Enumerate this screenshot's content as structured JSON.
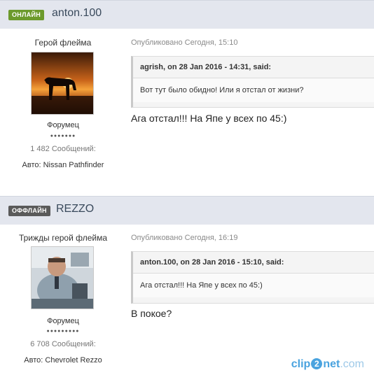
{
  "posts": [
    {
      "status": "ОНЛАЙН",
      "username": "anton.100",
      "rank": "Герой флейма",
      "group": "Форумец",
      "pips": "●●●●●●●",
      "post_count": "1 482 Сообщений:",
      "car": "Авто: Nissan Pathfinder",
      "published": "Опубликовано Сегодня, 15:10",
      "quote_header": "agrish, on 28 Jan 2016 - 14:31, said:",
      "quote_body": "Вот тут было обидно! Или я отстал от жизни?",
      "text": "Ага отстал!!! На Япе у всех по 45:)"
    },
    {
      "status": "ОФФЛАЙН",
      "username": "REZZO",
      "rank": "Трижды герой флейма",
      "group": "Форумец",
      "pips": "●●●●●●●●●",
      "post_count": "6 708 Сообщений:",
      "car": "Авто: Chevrolet Rezzo",
      "published": "Опубликовано Сегодня, 16:19",
      "quote_header": "anton.100, on 28 Jan 2016 - 15:10, said:",
      "quote_body": "Ага отстал!!! На Япе у всех по 45:)",
      "text": "В покое?"
    }
  ],
  "watermark": {
    "left": "clip",
    "mid": "2",
    "right": "net",
    "domain": ".com"
  },
  "colors": {
    "online": "#6c9a2c",
    "offline": "#5a5a5a",
    "header_bg": "#e3e6ee"
  }
}
